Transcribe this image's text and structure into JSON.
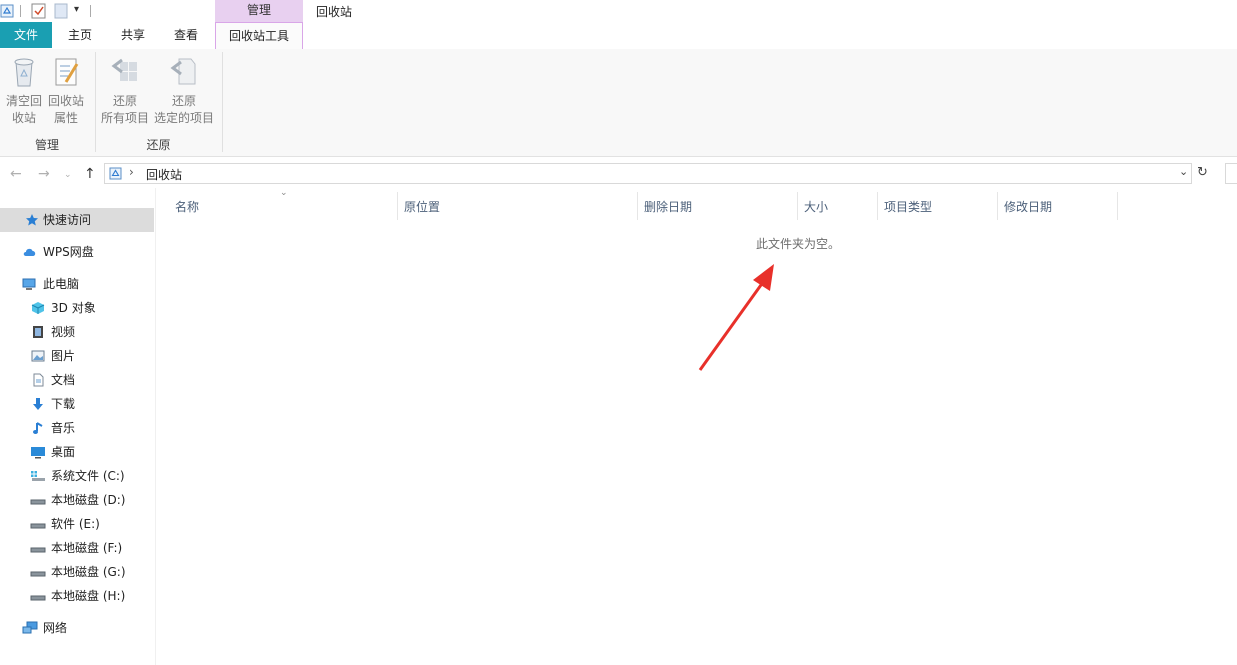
{
  "window": {
    "title": "回收站",
    "context_tab_group": "管理"
  },
  "tabs": [
    {
      "label": "文件"
    },
    {
      "label": "主页"
    },
    {
      "label": "共享"
    },
    {
      "label": "查看"
    },
    {
      "label": "回收站工具"
    }
  ],
  "ribbon": {
    "empty_bin": {
      "line1": "清空回",
      "line2": "收站"
    },
    "bin_properties": {
      "line1": "回收站",
      "line2": "属性"
    },
    "restore_all": {
      "line1": "还原",
      "line2": "所有项目"
    },
    "restore_selected": {
      "line1": "还原",
      "line2": "选定的项目"
    },
    "group_manage": "管理",
    "group_restore": "还原"
  },
  "address": {
    "separator": "›",
    "path": "回收站"
  },
  "sidebar": {
    "items": [
      {
        "label": "快速访问",
        "icon": "star-icon"
      },
      {
        "label": "WPS网盘",
        "icon": "cloud-icon"
      },
      {
        "label": "此电脑",
        "icon": "computer-icon"
      },
      {
        "label": "3D 对象",
        "icon": "cube-icon"
      },
      {
        "label": "视频",
        "icon": "film-icon"
      },
      {
        "label": "图片",
        "icon": "picture-icon"
      },
      {
        "label": "文档",
        "icon": "document-icon"
      },
      {
        "label": "下载",
        "icon": "download-arrow-icon"
      },
      {
        "label": "音乐",
        "icon": "music-note-icon"
      },
      {
        "label": "桌面",
        "icon": "desktop-icon"
      },
      {
        "label": "系统文件 (C:)",
        "icon": "system-drive-icon"
      },
      {
        "label": "本地磁盘 (D:)",
        "icon": "drive-icon"
      },
      {
        "label": "软件 (E:)",
        "icon": "drive-icon"
      },
      {
        "label": "本地磁盘 (F:)",
        "icon": "drive-icon"
      },
      {
        "label": "本地磁盘 (G:)",
        "icon": "drive-icon"
      },
      {
        "label": "本地磁盘 (H:)",
        "icon": "drive-icon"
      },
      {
        "label": "网络",
        "icon": "network-icon"
      }
    ]
  },
  "columns": [
    "名称",
    "原位置",
    "删除日期",
    "大小",
    "项目类型",
    "修改日期"
  ],
  "empty_message": "此文件夹为空。",
  "colors": {
    "file_tab": "#1a9fb2",
    "context_tab": "#e8d0f0",
    "annotation_arrow": "#e8302a",
    "selected_sidebar": "#dcdcdc"
  }
}
